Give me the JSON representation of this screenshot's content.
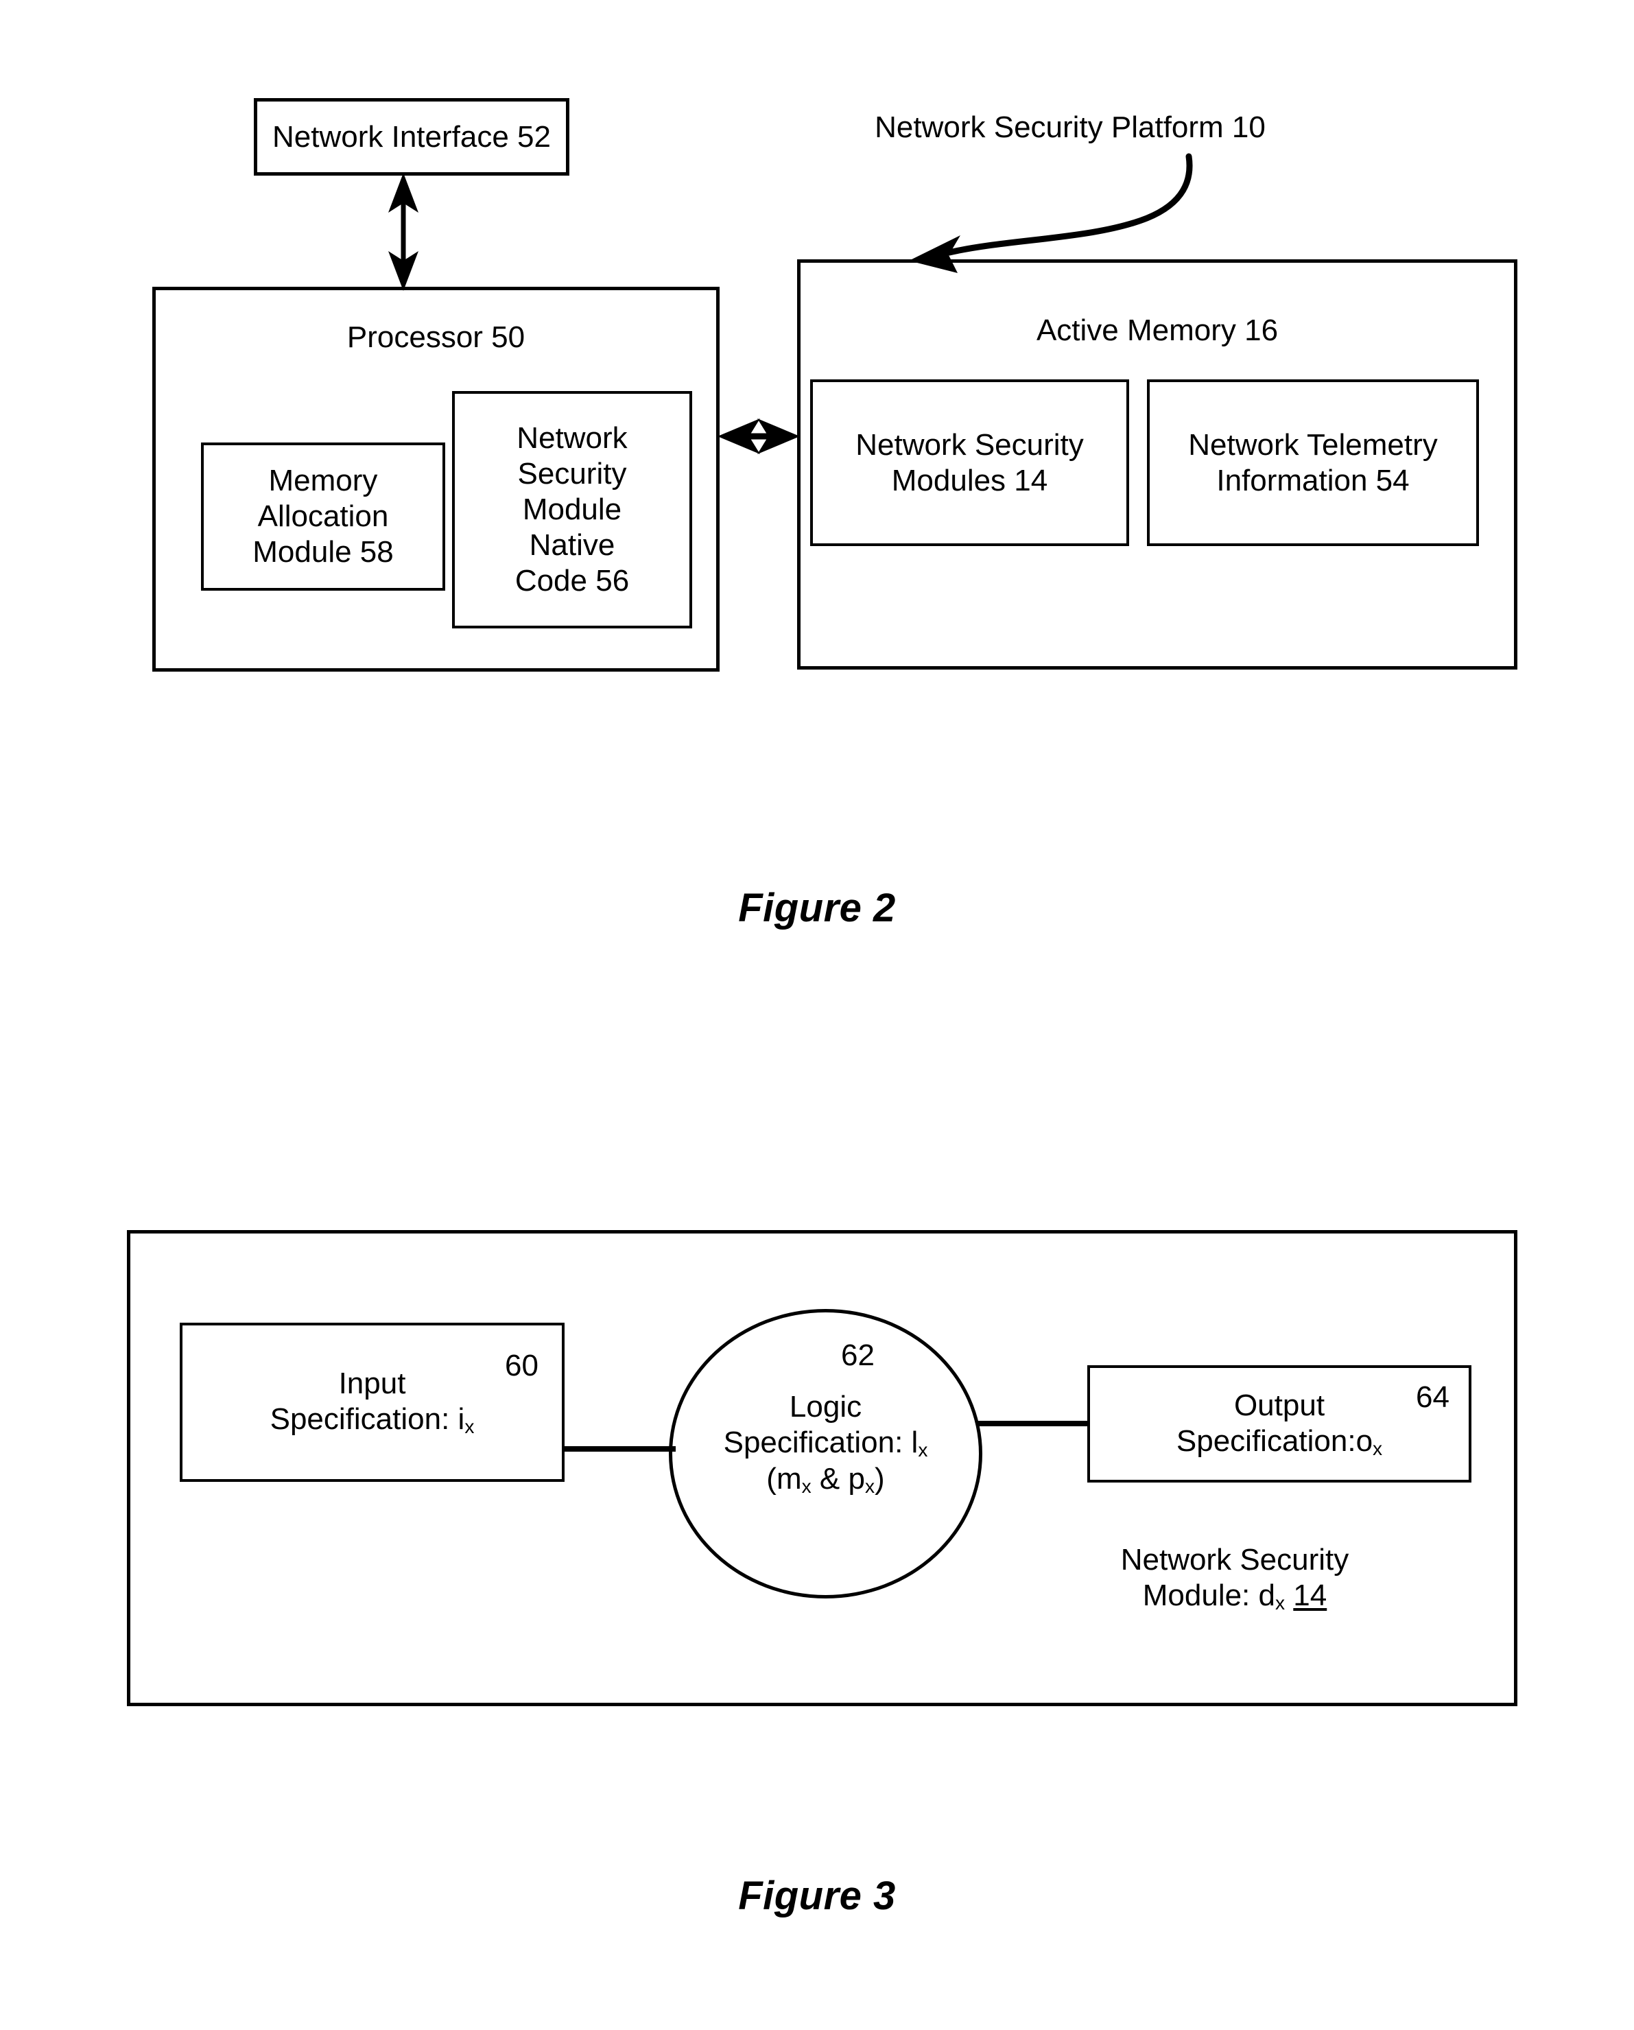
{
  "figure2": {
    "caption": "Figure 2",
    "platform_callout": "Network Security Platform 10",
    "network_interface": "Network Interface 52",
    "processor_title": "Processor 50",
    "memory_allocation_module": "Memory\nAllocation\nModule 58",
    "native_code_module": "Network\nSecurity\nModule\nNative\nCode 56",
    "active_memory_title": "Active Memory 16",
    "network_security_modules": "Network Security\nModules 14",
    "network_telemetry_information": "Network Telemetry\nInformation 54"
  },
  "figure3": {
    "caption": "Figure 3",
    "input_label_line1": "Input",
    "input_label_line2_prefix": "Specification: i",
    "input_label_line2_sub": "x",
    "input_ref": "60",
    "logic_ref": "62",
    "logic_line1": "Logic",
    "logic_line2_prefix": "Specification: l",
    "logic_line2_sub": "x",
    "logic_line3_open": "(m",
    "logic_line3_sub1": "x",
    "logic_line3_mid": " & p",
    "logic_line3_sub2": "x",
    "logic_line3_close": ")",
    "output_label_line1": "Output",
    "output_label_line2_prefix": "Specification:o",
    "output_label_line2_sub": "x",
    "output_ref": "64",
    "module_label_line1": "Network Security",
    "module_label_line2_prefix": "Module: d",
    "module_label_line2_sub": "x",
    "module_label_ref": "14"
  },
  "colors": {
    "stroke": "#000000",
    "background": "#ffffff"
  }
}
